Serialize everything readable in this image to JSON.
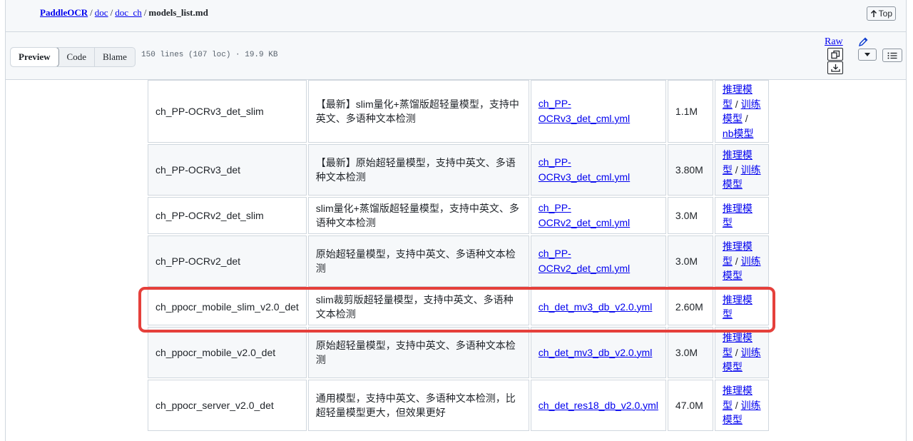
{
  "breadcrumb": {
    "repo": "PaddleOCR",
    "dir1": "doc",
    "dir2": "doc_ch",
    "file": "models_list.md",
    "top_label": "Top"
  },
  "toolbar": {
    "tabs": [
      "Preview",
      "Code",
      "Blame"
    ],
    "file_meta": "150 lines (107 loc) · 19.9 KB",
    "raw_label": "Raw"
  },
  "table": {
    "rows": [
      {
        "name": "ch_PP-OCRv3_det_slim",
        "desc": "【最新】slim量化+蒸馏版超轻量模型，支持中英文、多语种文本检测",
        "config": "ch_PP-OCRv3_det_cml.yml",
        "size": "1.1M",
        "links": [
          "推理模型",
          "训练模型",
          "nb模型"
        ]
      },
      {
        "name": "ch_PP-OCRv3_det",
        "desc": "【最新】原始超轻量模型，支持中英文、多语种文本检测",
        "config": "ch_PP-OCRv3_det_cml.yml",
        "size": "3.80M",
        "links": [
          "推理模型",
          "训练模型"
        ]
      },
      {
        "name": "ch_PP-OCRv2_det_slim",
        "desc": "slim量化+蒸馏版超轻量模型，支持中英文、多语种文本检测",
        "config": "ch_PP-OCRv2_det_cml.yml",
        "size": "3.0M",
        "links": [
          "推理模型"
        ]
      },
      {
        "name": "ch_PP-OCRv2_det",
        "desc": "原始超轻量模型，支持中英文、多语种文本检测",
        "config": "ch_PP-OCRv2_det_cml.yml",
        "size": "3.0M",
        "links": [
          "推理模型",
          "训练模型"
        ]
      },
      {
        "name": "ch_ppocr_mobile_slim_v2.0_det",
        "desc": "slim裁剪版超轻量模型，支持中英文、多语种文本检测",
        "config": "ch_det_mv3_db_v2.0.yml",
        "size": "2.60M",
        "links": [
          "推理模型"
        ]
      },
      {
        "name": "ch_ppocr_mobile_v2.0_det",
        "desc": "原始超轻量模型，支持中英文、多语种文本检测",
        "config": "ch_det_mv3_db_v2.0.yml",
        "size": "3.0M",
        "links": [
          "推理模型",
          "训练模型"
        ]
      },
      {
        "name": "ch_ppocr_server_v2.0_det",
        "desc": "通用模型，支持中英文、多语种文本检测，比超轻量模型更大，但效果更好",
        "config": "ch_det_res18_db_v2.0.yml",
        "size": "47.0M",
        "links": [
          "推理模型",
          "训练模型"
        ]
      }
    ]
  },
  "highlight_color": "#e5403b"
}
